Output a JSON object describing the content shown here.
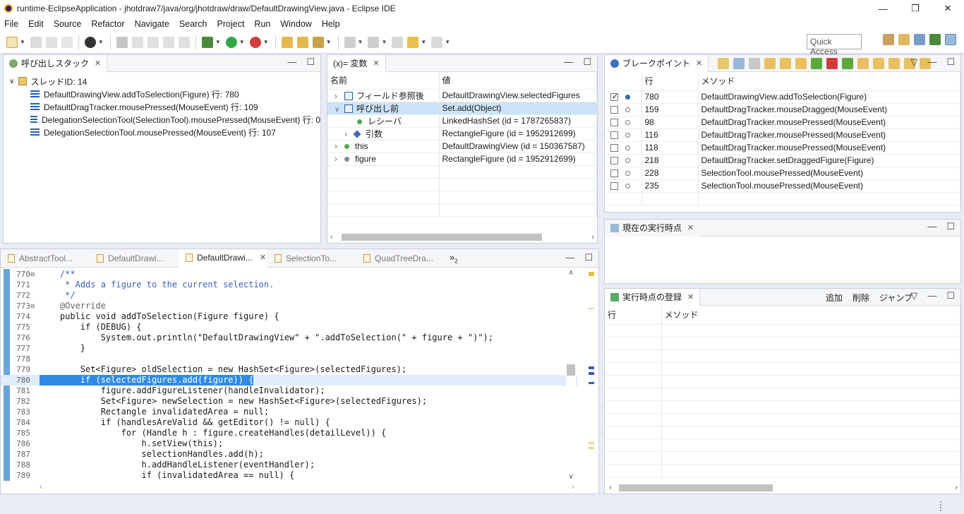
{
  "window": {
    "title": "runtime-EclipseApplication - jhotdraw7/java/org/jhotdraw/draw/DefaultDrawingView.java - Eclipse IDE",
    "minimize": "—",
    "restore": "❒",
    "close": "✕"
  },
  "menu": [
    "File",
    "Edit",
    "Source",
    "Refactor",
    "Navigate",
    "Search",
    "Project",
    "Run",
    "Window",
    "Help"
  ],
  "quick_access": "Quick Access",
  "callstack": {
    "tab": "呼び出しスタック",
    "thread": "スレッドID: 14",
    "frames": [
      "DefaultDrawingView.addToSelection(Figure) 行: 780",
      "DefaultDragTracker.mousePressed(MouseEvent) 行: 109",
      "DelegationSelectionTool(SelectionTool).mousePressed(MouseEvent) 行: 0",
      "DelegationSelectionTool.mousePressed(MouseEvent) 行: 107"
    ]
  },
  "variables": {
    "tab": "(x)= 変数",
    "col_name": "名前",
    "col_value": "値",
    "rows": [
      {
        "name": "フィールド参照後",
        "value": "DefaultDrawingView.selectedFigures",
        "indent": 0,
        "arrow": ">",
        "icon": "field-access-icon"
      },
      {
        "name": "呼び出し前",
        "value": "Set.add(Object)",
        "indent": 0,
        "arrow": "v",
        "icon": "method-entry-icon",
        "selected": true
      },
      {
        "name": "レシーバ",
        "value": "LinkedHashSet (id = 1787265837)",
        "indent": 1,
        "arrow": "",
        "icon": "green-dot-icon"
      },
      {
        "name": "引数",
        "value": "RectangleFigure (id = 1952912699)",
        "indent": 1,
        "arrow": ">",
        "icon": "blue-diamond-icon"
      },
      {
        "name": "this",
        "value": "DefaultDrawingView (id = 150367587)",
        "indent": 0,
        "arrow": ">",
        "icon": "green-dot-icon"
      },
      {
        "name": "figure",
        "value": "RectangleFigure (id = 1952912699)",
        "indent": 0,
        "arrow": ">",
        "icon": "local-var-icon"
      }
    ]
  },
  "breakpoints": {
    "tab": "ブレークポイント",
    "col_line": "行",
    "col_method": "メソッド",
    "rows": [
      {
        "checked": true,
        "line": "780",
        "method": "DefaultDrawingView.addToSelection(Figure)"
      },
      {
        "checked": false,
        "line": "159",
        "method": "DefaultDragTracker.mouseDragged(MouseEvent)"
      },
      {
        "checked": false,
        "line": "98",
        "method": "DefaultDragTracker.mousePressed(MouseEvent)"
      },
      {
        "checked": false,
        "line": "116",
        "method": "DefaultDragTracker.mousePressed(MouseEvent)"
      },
      {
        "checked": false,
        "line": "118",
        "method": "DefaultDragTracker.mousePressed(MouseEvent)"
      },
      {
        "checked": false,
        "line": "218",
        "method": "DefaultDragTracker.setDraggedFigure(Figure)"
      },
      {
        "checked": false,
        "line": "228",
        "method": "SelectionTool.mousePressed(MouseEvent)"
      },
      {
        "checked": false,
        "line": "235",
        "method": "SelectionTool.mousePressed(MouseEvent)"
      }
    ]
  },
  "current_point": {
    "tab": "現在の実行時点"
  },
  "registry": {
    "tab": "実行時点の登録",
    "add": "追加",
    "delete": "削除",
    "jump": "ジャンプ",
    "col_line": "行",
    "col_method": "メソッド"
  },
  "editor": {
    "tabs": [
      "AbstractTool...",
      "DefaultDrawi...",
      "DefaultDrawi...",
      "SelectionTo...",
      "QuadTreeDra..."
    ],
    "active_tab": 2,
    "overflow": "»",
    "overflow_count": "2",
    "current_line": "780",
    "lines": [
      {
        "n": "770⊖",
        "t": "    /**"
      },
      {
        "n": "771",
        "t": "     * Adds a figure to the current selection."
      },
      {
        "n": "772",
        "t": "     */"
      },
      {
        "n": "773⊖",
        "t": "    @Override"
      },
      {
        "n": "774",
        "t": "    public void addToSelection(Figure figure) {"
      },
      {
        "n": "775",
        "t": "        if (DEBUG) {"
      },
      {
        "n": "776",
        "t": "            System.out.println(\"DefaultDrawingView\" + \".addToSelection(\" + figure + \")\");"
      },
      {
        "n": "777",
        "t": "        }"
      },
      {
        "n": "778",
        "t": ""
      },
      {
        "n": "779",
        "t": "        Set<Figure> oldSelection = new HashSet<Figure>(selectedFigures);"
      },
      {
        "n": "780",
        "t": "        if (selectedFigures.add(figure)) {"
      },
      {
        "n": "781",
        "t": "            figure.addFigureListener(handleInvalidator);"
      },
      {
        "n": "782",
        "t": "            Set<Figure> newSelection = new HashSet<Figure>(selectedFigures);"
      },
      {
        "n": "783",
        "t": "            Rectangle invalidatedArea = null;"
      },
      {
        "n": "784",
        "t": "            if (handlesAreValid && getEditor() != null) {"
      },
      {
        "n": "785",
        "t": "                for (Handle h : figure.createHandles(detailLevel)) {"
      },
      {
        "n": "786",
        "t": "                    h.setView(this);"
      },
      {
        "n": "787",
        "t": "                    selectionHandles.add(h);"
      },
      {
        "n": "788",
        "t": "                    h.addHandleListener(eventHandler);"
      },
      {
        "n": "789",
        "t": "                    if (invalidatedArea == null) {"
      }
    ]
  }
}
